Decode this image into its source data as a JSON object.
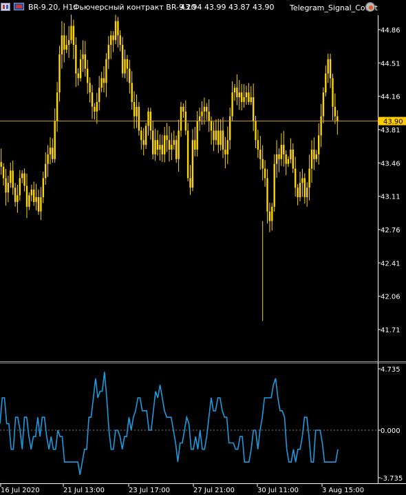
{
  "header": {
    "symbol_info": "BR-9.20, H1:",
    "description": "Фьючерсный контракт BR-9.20",
    "ohlc": "43.94 43.99 43.87 43.90",
    "expert_name": "Telegram_Signal_Count"
  },
  "colors": {
    "background": "#000000",
    "candle": "#FFD700",
    "price_line": "#D4A017",
    "price_tag_bg": "#FFCC00",
    "indicator": "#1E9BE0",
    "axis_text": "#FFFFFF",
    "separator": "#9A9A9A",
    "zero_line": "#808080"
  },
  "current_price_label": "43.90",
  "price_axis_labels": [
    "44.86",
    "44.51",
    "44.16",
    "43.81",
    "43.46",
    "43.11",
    "42.76",
    "42.41",
    "42.06",
    "41.71"
  ],
  "indicator_axis_labels": [
    "4.735",
    "0.000",
    "-3.735"
  ],
  "time_axis_labels": [
    "16 Jul 2020",
    "21 Jul 13:00",
    "23 Jul 17:00",
    "27 Jul 21:00",
    "30 Jul 11:00",
    "3 Aug 15:00"
  ],
  "chart_data": [
    {
      "type": "candlestick",
      "title": "BR-9.20, H1",
      "ylim": [
        41.55,
        45.05
      ],
      "current_price": 43.9,
      "x": [
        "16 Jul 2020",
        "21 Jul 13:00",
        "23 Jul 17:00",
        "27 Jul 21:00",
        "30 Jul 11:00",
        "3 Aug 15:00"
      ],
      "series": [
        {
          "close": [
            43.42,
            43.3,
            43.15,
            43.25,
            43.38,
            43.2,
            43.05,
            43.12,
            43.3,
            43.35,
            43.22,
            43.0,
            43.12,
            43.18,
            43.05,
            43.1,
            42.95,
            43.1,
            43.3,
            43.45,
            43.55,
            43.62,
            43.5,
            43.9,
            44.2,
            44.6,
            44.8,
            44.65,
            44.7,
            44.75,
            44.9,
            44.7,
            44.4,
            44.35,
            44.55,
            44.6,
            44.45,
            44.3,
            44.2,
            44.05,
            44.0,
            44.1,
            44.25,
            44.35,
            44.3,
            44.55,
            44.7,
            44.8,
            44.75,
            44.95,
            44.8,
            44.7,
            44.4,
            44.55,
            44.45,
            44.3,
            44.1,
            43.95,
            44.05,
            43.8,
            43.7,
            43.65,
            43.85,
            44.0,
            43.8,
            43.55,
            43.7,
            43.6,
            43.65,
            43.55,
            43.75,
            43.7,
            43.6,
            43.65,
            43.7,
            43.5,
            43.8,
            44.05,
            44.0,
            43.8,
            43.3,
            43.2,
            43.7,
            43.6,
            43.9,
            43.95,
            44.0,
            44.05,
            44.0,
            43.9,
            43.8,
            43.7,
            43.8,
            43.65,
            43.8,
            43.6,
            43.55,
            43.7,
            43.95,
            44.2,
            44.25,
            44.15,
            44.2,
            44.1,
            44.15,
            44.2,
            44.1,
            44.15,
            43.9,
            43.7,
            43.6,
            43.5,
            43.4,
            43.3,
            42.95,
            42.85,
            43.0,
            43.45,
            43.55,
            43.5,
            43.65,
            43.55,
            43.45,
            43.5,
            43.6,
            43.4,
            43.2,
            43.1,
            43.25,
            43.3,
            43.1,
            43.2,
            43.4,
            43.6,
            43.5,
            43.55,
            43.75,
            43.95,
            44.2,
            44.4,
            44.55,
            44.35,
            44.05,
            43.95,
            43.9
          ]
        }
      ]
    },
    {
      "type": "line",
      "ylim": [
        -3.735,
        4.735
      ],
      "series": [
        {
          "values": [
            0.5,
            2.5,
            2.5,
            0.5,
            0.5,
            -1.5,
            -1.5,
            1.0,
            1.0,
            0.0,
            -1.5,
            1.0,
            1.0,
            -0.5,
            -1.5,
            -0.5,
            -0.5,
            1.0,
            -0.5,
            1.0,
            1.0,
            -0.5,
            -1.5,
            -0.5,
            -1.5,
            -1.5,
            0.0,
            -0.5,
            -0.5,
            -2.5,
            -2.5,
            -2.5,
            -2.5,
            -2.5,
            -2.5,
            -2.5,
            -3.5,
            -2.5,
            -1.5,
            -1.5,
            1.0,
            1.0,
            2.5,
            4.0,
            2.5,
            3.0,
            3.0,
            4.5,
            2.5,
            0.0,
            -1.5,
            -1.5,
            0.0,
            0.0,
            -0.5,
            -1.5,
            -0.5,
            -0.5,
            1.0,
            0.0,
            1.0,
            1.5,
            2.5,
            2.5,
            1.5,
            1.5,
            1.5,
            0.0,
            0.0,
            1.5,
            3.0,
            2.5,
            3.5,
            2.5,
            1.5,
            1.0,
            1.0,
            1.0,
            0.0,
            -1.0,
            -2.5,
            -1.0,
            -1.0,
            0.0,
            1.0,
            0.5,
            -1.5,
            -1.5,
            -0.5,
            -1.5,
            0.0,
            -1.5,
            -1.5,
            -0.5,
            1.0,
            2.5,
            1.5,
            1.5,
            2.5,
            2.5,
            1.5,
            1.0,
            1.0,
            -1.0,
            -1.0,
            -1.0,
            -1.5,
            -1.5,
            -0.5,
            -0.5,
            -2.5,
            -2.5,
            -2.5,
            -1.5,
            0.0,
            0.0,
            -1.5,
            0.0,
            1.0,
            2.5,
            2.5,
            2.5,
            2.5,
            3.5,
            4.0,
            2.5,
            1.5,
            1.5,
            1.0,
            -1.5,
            -2.5,
            -2.5,
            -1.5,
            -2.5,
            -1.5,
            -1.5,
            -0.5,
            1.0,
            1.0,
            -0.5,
            -2.5,
            -2.5,
            0.0,
            0.0,
            0.0,
            -1.0,
            -2.5,
            -2.5,
            -2.5,
            -2.5,
            -2.5,
            -2.5,
            -1.5
          ]
        }
      ]
    }
  ]
}
